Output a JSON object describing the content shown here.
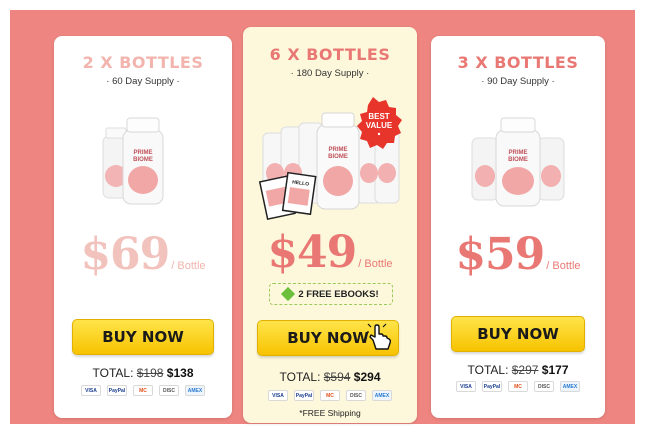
{
  "colors": {
    "background": "#ee8580",
    "accent_pink": "#e97874",
    "faded_pink": "#f2b4ad",
    "featured_card": "#fdf8dc",
    "button_yellow": "#f7c300"
  },
  "offers": [
    {
      "title": "2 X BOTTLES",
      "supply": "· 60 Day Supply ·",
      "bottle_label": "PRIME BIOME",
      "price": "$69",
      "unit": "/ Bottle",
      "buy_label": "BUY NOW",
      "total_label": "TOTAL:",
      "total_old": "$198",
      "total_new": "$138"
    },
    {
      "title": "6 X BOTTLES",
      "supply": "· 180 Day Supply ·",
      "bottle_label": "PRIME BIOME",
      "badge_line1": "BEST",
      "badge_line2": "VALUE",
      "ebook_cover": "HELLO",
      "price": "$49",
      "unit": "/ Bottle",
      "bonus": "2 FREE EBOOKS!",
      "buy_label": "BUY NOW",
      "total_label": "TOTAL:",
      "total_old": "$594",
      "total_new": "$294",
      "shipping": "*FREE Shipping"
    },
    {
      "title": "3 X BOTTLES",
      "supply": "· 90 Day Supply ·",
      "bottle_label": "PRIME BIOME",
      "price": "$59",
      "unit": "/ Bottle",
      "buy_label": "BUY NOW",
      "total_label": "TOTAL:",
      "total_old": "$297",
      "total_new": "$177"
    }
  ],
  "payment_methods": [
    {
      "label": "VISA",
      "icon": "visa-icon"
    },
    {
      "label": "PayPal",
      "icon": "paypal-icon"
    },
    {
      "label": "MC",
      "icon": "mastercard-icon"
    },
    {
      "label": "DISC",
      "icon": "discover-icon"
    },
    {
      "label": "AMEX",
      "icon": "amex-icon"
    }
  ]
}
